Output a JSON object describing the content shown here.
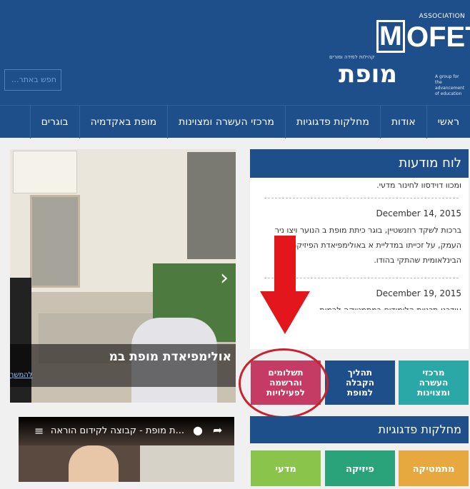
{
  "header": {
    "search_placeholder": "חפש באתר...",
    "logo_association": "ASSOCIATION",
    "logo_brand_latin": "OFET",
    "logo_brand_m": "M",
    "logo_brand_hebrew": "מופת",
    "logo_small_hebrew": "קהילות למידה ומורים",
    "logo_tagline": "A group for the advancement of education"
  },
  "nav": {
    "items": [
      "ראשי",
      "אודות",
      "מחלקות פדגוגיות",
      "מרכזי העשרה ומצוינות",
      "מופת באקדמיה",
      "בוגרים"
    ]
  },
  "slider": {
    "caption_title": "אולימפיאדת מופת במ",
    "caption_link": "להמשך"
  },
  "video": {
    "title": "...ת מופת - קבוצה לקידום הוראה"
  },
  "news": {
    "title": "לוח מודעות",
    "cut_text": "ומכון דוידסון לחינוך מדעי.",
    "items": [
      {
        "date": "December 14, 2015",
        "body": "ברכות לשקד רוזנשטיין, בוגר כיתת מופת ב הנוער ויצו ניר העמק, על זכייתו במדליית א באולימפיאדת הפיזיקה הבינלאומית שהתקי בהודו."
      },
      {
        "date": "December 19, 2015",
        "body": "עודכנו תכניות הלימודים במתמטיקה לרמות"
      }
    ]
  },
  "quick_links": {
    "payments": "תשלומים והרשמה לפעילויות",
    "admission": "תהליך הקבלה למופת",
    "enrichment": "מרכזי העשרה ומצוינות"
  },
  "departments": {
    "title": "מחלקות פדגוגיות",
    "items": [
      "מתמטיקה",
      "פיזיקה",
      "מדעי"
    ]
  },
  "colors": {
    "primary": "#1e4f8a",
    "pink": "#c53b63",
    "teal": "#2aa7a7",
    "highlight": "#c8232c"
  }
}
